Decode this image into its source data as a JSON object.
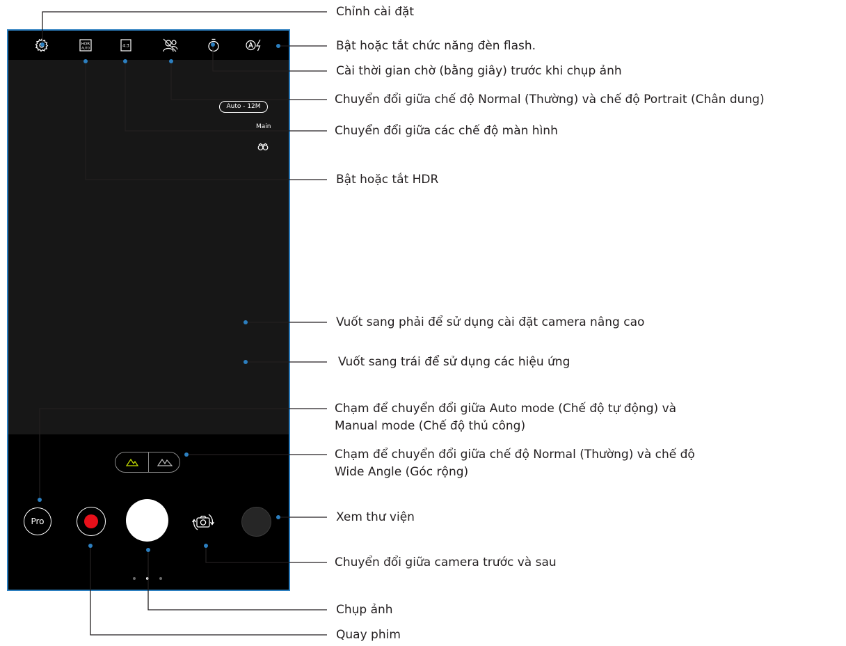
{
  "camera": {
    "resolution_chip": "Auto - 12M",
    "camera_label": "Main",
    "pro_label": "Pro",
    "toolbar_icons": [
      "gear-icon",
      "hdr-auto-icon",
      "aspect-ratio-icon",
      "portrait-mode-icon",
      "timer-icon",
      "flash-auto-icon"
    ],
    "page_dots": 3,
    "active_page_dot": 2,
    "colors": {
      "frame_border": "#2c7fc0",
      "record_dot": "#e8101a",
      "lens_active": "#c8e000",
      "callout_line": "#231f20"
    }
  },
  "callouts": {
    "settings": "Chỉnh cài đặt",
    "flash": "Bật hoặc tắt chức năng đèn flash.",
    "timer": "Cài thời gian chờ (bằng giây) trước khi chụp ảnh",
    "portrait": "Chuyển đổi giữa chế độ Normal (Thường) và chế độ Portrait (Chân dung)",
    "aspect": "Chuyển đổi giữa các chế độ màn hình",
    "hdr": "Bật hoặc tắt HDR",
    "swipe_right": "Vuốt sang phải để sử dụng cài đặt camera nâng cao",
    "swipe_left": "Vuốt sang trái để sử dụng các hiệu ứng",
    "pro_line1": "Chạm để chuyển đổi giữa Auto mode (Chế độ tự động) và",
    "pro_line2": "Manual mode (Chế độ thủ công)",
    "lens_line1": "Chạm để chuyển đổi giữa chế độ Normal (Thường) và chế độ",
    "lens_line2": "Wide Angle (Góc rộng)",
    "gallery": "Xem thư viện",
    "switch_camera": "Chuyển đổi giữa camera trước và sau",
    "capture": "Chụp ảnh",
    "record": "Quay phim"
  }
}
